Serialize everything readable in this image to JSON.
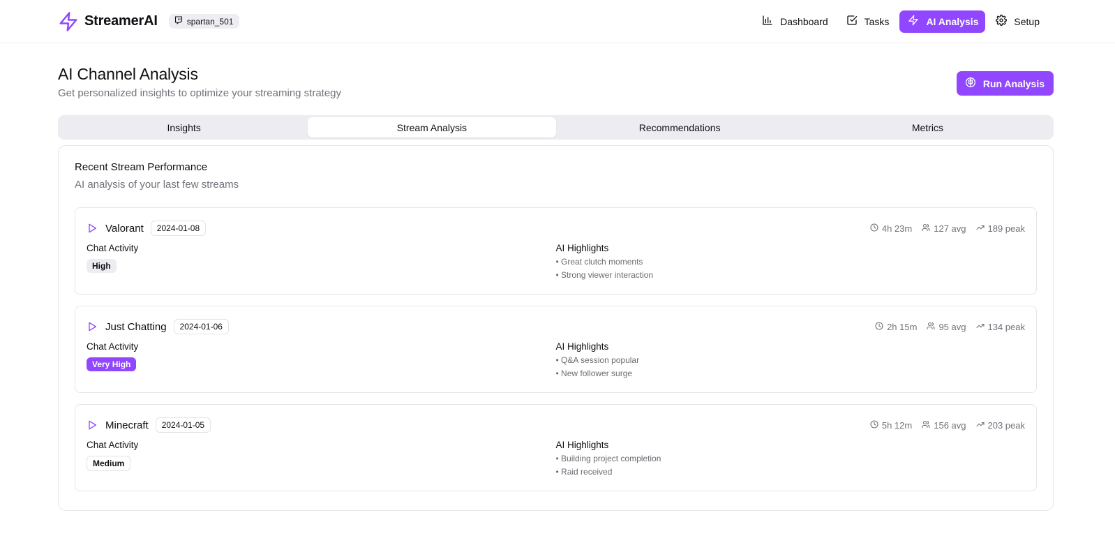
{
  "header": {
    "brand": "StreamerAI",
    "username": "spartan_501",
    "nav": [
      {
        "label": "Dashboard",
        "icon": "bar-chart-icon"
      },
      {
        "label": "Tasks",
        "icon": "check-square-icon"
      },
      {
        "label": "AI Analysis",
        "icon": "zap-icon",
        "active": true
      },
      {
        "label": "Setup",
        "icon": "gear-icon"
      }
    ]
  },
  "page": {
    "title": "AI Channel Analysis",
    "subtitle": "Get personalized insights to optimize your streaming strategy",
    "run_button": "Run Analysis"
  },
  "tabs": [
    {
      "label": "Insights",
      "active": false
    },
    {
      "label": "Stream Analysis",
      "active": true
    },
    {
      "label": "Recommendations",
      "active": false
    },
    {
      "label": "Metrics",
      "active": false
    }
  ],
  "card": {
    "title": "Recent Stream Performance",
    "subtitle": "AI analysis of your last few streams",
    "chat_label": "Chat Activity",
    "highlights_label": "AI Highlights",
    "streams": [
      {
        "game": "Valorant",
        "date": "2024-01-08",
        "duration": "4h 23m",
        "avg": "127 avg",
        "peak": "189 peak",
        "activity": "High",
        "highlights": [
          "• Great clutch moments",
          "• Strong viewer interaction"
        ]
      },
      {
        "game": "Just Chatting",
        "date": "2024-01-06",
        "duration": "2h 15m",
        "avg": "95 avg",
        "peak": "134 peak",
        "activity": "Very High",
        "highlights": [
          "• Q&A session popular",
          "• New follower surge"
        ]
      },
      {
        "game": "Minecraft",
        "date": "2024-01-05",
        "duration": "5h 12m",
        "avg": "156 avg",
        "peak": "203 peak",
        "activity": "Medium",
        "highlights": [
          "• Building project completion",
          "• Raid received"
        ]
      }
    ]
  },
  "colors": {
    "accent": "#9146ff",
    "muted": "#71717a",
    "border": "#e6e6ea",
    "tab_bg": "#ececf1"
  }
}
